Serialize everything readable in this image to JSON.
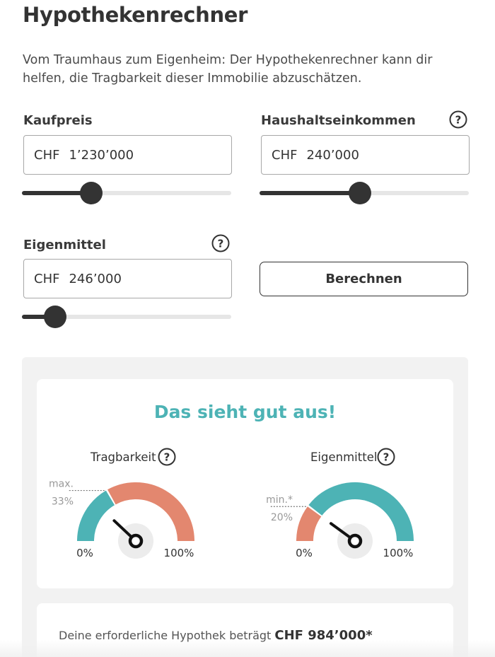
{
  "page": {
    "title": "Hypothekenrechner",
    "intro": "Vom Traumhaus zum Eigenheim: Der Hypothekenrechner kann dir helfen, die Tragbarkeit dieser Immobilie abzuschätzen."
  },
  "form": {
    "kaufpreis": {
      "label": "Kaufpreis",
      "currency": "CHF",
      "value": "1’230’000",
      "slider_fraction": 0.33
    },
    "einkommen": {
      "label": "Haushaltseinkommen",
      "currency": "CHF",
      "value": "240’000",
      "slider_fraction": 0.48
    },
    "eigenmittel": {
      "label": "Eigenmittel",
      "currency": "CHF",
      "value": "246’000",
      "slider_fraction": 0.16
    },
    "calculate_label": "Berechnen",
    "help_glyph": "?"
  },
  "result": {
    "heading": "Das sieht gut aus!",
    "gauges": [
      {
        "title": "Tragbarkeit",
        "threshold_label": "max.",
        "threshold_value": "33%",
        "threshold_fraction": 0.33,
        "needle_fraction": 0.24,
        "min_label": "0%",
        "max_label": "100%",
        "below_color": "#4db3b5",
        "above_color": "#e3876f"
      },
      {
        "title": "Eigenmittel",
        "threshold_label": "min.*",
        "threshold_value": "20%",
        "threshold_fraction": 0.2,
        "needle_fraction": 0.2,
        "min_label": "0%",
        "max_label": "100%",
        "below_color": "#e3876f",
        "above_color": "#4db3b5"
      }
    ],
    "mortgage_prefix": "Deine erforderliche Hypothek beträgt",
    "mortgage_value": "CHF 984’000*"
  },
  "colors": {
    "accent": "#4db3b5",
    "warning": "#e3876f",
    "dark": "#333333"
  }
}
